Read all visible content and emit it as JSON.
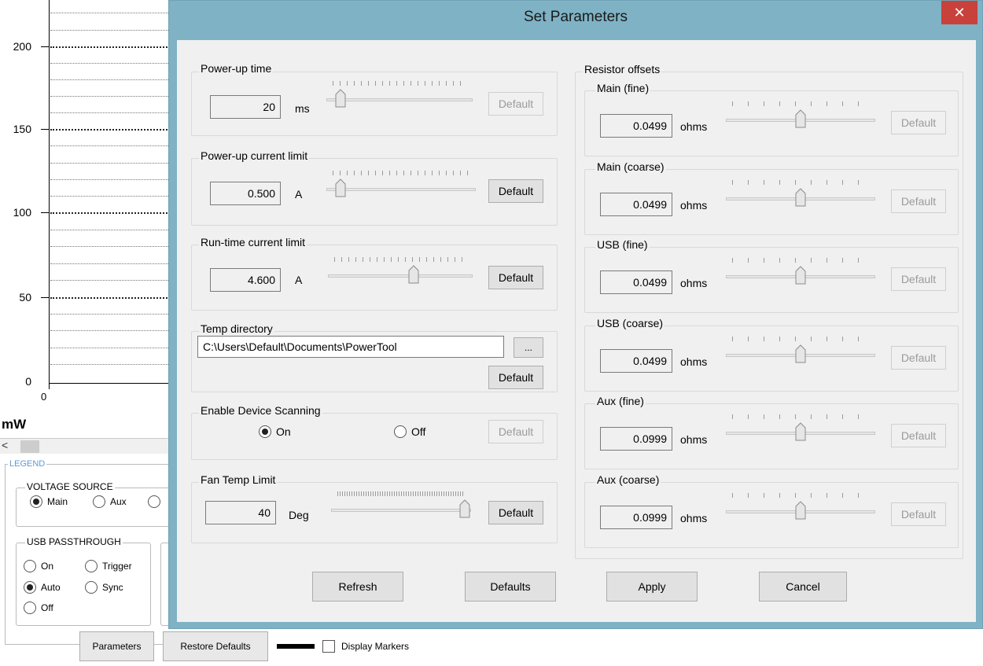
{
  "background_app": {
    "y_ticks": [
      "200",
      "150",
      "100",
      "50",
      "0"
    ],
    "x_tick": "0",
    "unit_label": "mW",
    "scroll_left_arrow": "<",
    "legend_title": "LEGEND",
    "voltage_source": {
      "title": "VOLTAGE SOURCE",
      "options": [
        {
          "label": "Main",
          "selected": true
        },
        {
          "label": "Aux",
          "selected": false
        }
      ]
    },
    "usb_passthrough": {
      "title": "USB PASSTHROUGH",
      "options": [
        {
          "label": "On",
          "selected": false
        },
        {
          "label": "Trigger",
          "selected": false
        },
        {
          "label": "Auto",
          "selected": true
        },
        {
          "label": "Sync",
          "selected": false
        },
        {
          "label": "Off",
          "selected": false
        }
      ]
    },
    "buttons": {
      "parameters": "Parameters",
      "restore_defaults": "Restore Defaults"
    },
    "display_markers": {
      "label": "Display Markers",
      "checked": false
    }
  },
  "dialog": {
    "title": "Set Parameters",
    "close_glyph": "✕",
    "power_up_time": {
      "title": "Power-up time",
      "value": "20",
      "unit": "ms",
      "slider_fraction": 0.06,
      "default_label": "Default",
      "default_enabled": false
    },
    "power_up_current_limit": {
      "title": "Power-up current limit",
      "value": "0.500",
      "unit": "A",
      "slider_fraction": 0.06,
      "default_label": "Default",
      "default_enabled": true
    },
    "run_time_current_limit": {
      "title": "Run-time current limit",
      "value": "4.600",
      "unit": "A",
      "slider_fraction": 0.6,
      "default_label": "Default",
      "default_enabled": true
    },
    "temp_directory": {
      "title": "Temp directory",
      "path": "C:\\Users\\Default\\Documents\\PowerTool",
      "browse_label": "...",
      "default_label": "Default"
    },
    "device_scanning": {
      "title": "Enable Device Scanning",
      "on_label": "On",
      "off_label": "Off",
      "selected": "On",
      "default_label": "Default"
    },
    "fan_temp_limit": {
      "title": "Fan Temp Limit",
      "value": "40",
      "unit": "Deg",
      "slider_fraction": 1.0,
      "default_label": "Default"
    },
    "resistor_offsets": {
      "title": "Resistor offsets",
      "items": [
        {
          "title": "Main (fine)",
          "value": "0.0499",
          "unit": "ohms",
          "slider_fraction": 0.5,
          "default_label": "Default"
        },
        {
          "title": "Main (coarse)",
          "value": "0.0499",
          "unit": "ohms",
          "slider_fraction": 0.5,
          "default_label": "Default"
        },
        {
          "title": "USB (fine)",
          "value": "0.0499",
          "unit": "ohms",
          "slider_fraction": 0.5,
          "default_label": "Default"
        },
        {
          "title": "USB (coarse)",
          "value": "0.0499",
          "unit": "ohms",
          "slider_fraction": 0.5,
          "default_label": "Default"
        },
        {
          "title": "Aux (fine)",
          "value": "0.0999",
          "unit": "ohms",
          "slider_fraction": 0.5,
          "default_label": "Default"
        },
        {
          "title": "Aux (coarse)",
          "value": "0.0999",
          "unit": "ohms",
          "slider_fraction": 0.5,
          "default_label": "Default"
        }
      ]
    },
    "footer_buttons": {
      "refresh": "Refresh",
      "defaults": "Defaults",
      "apply": "Apply",
      "cancel": "Cancel"
    }
  },
  "colors": {
    "title_bar": "#7fb2c5",
    "close_button": "#c8413b",
    "dialog_face": "#f0f0f0",
    "legend_accent": "#5b9bd5"
  }
}
